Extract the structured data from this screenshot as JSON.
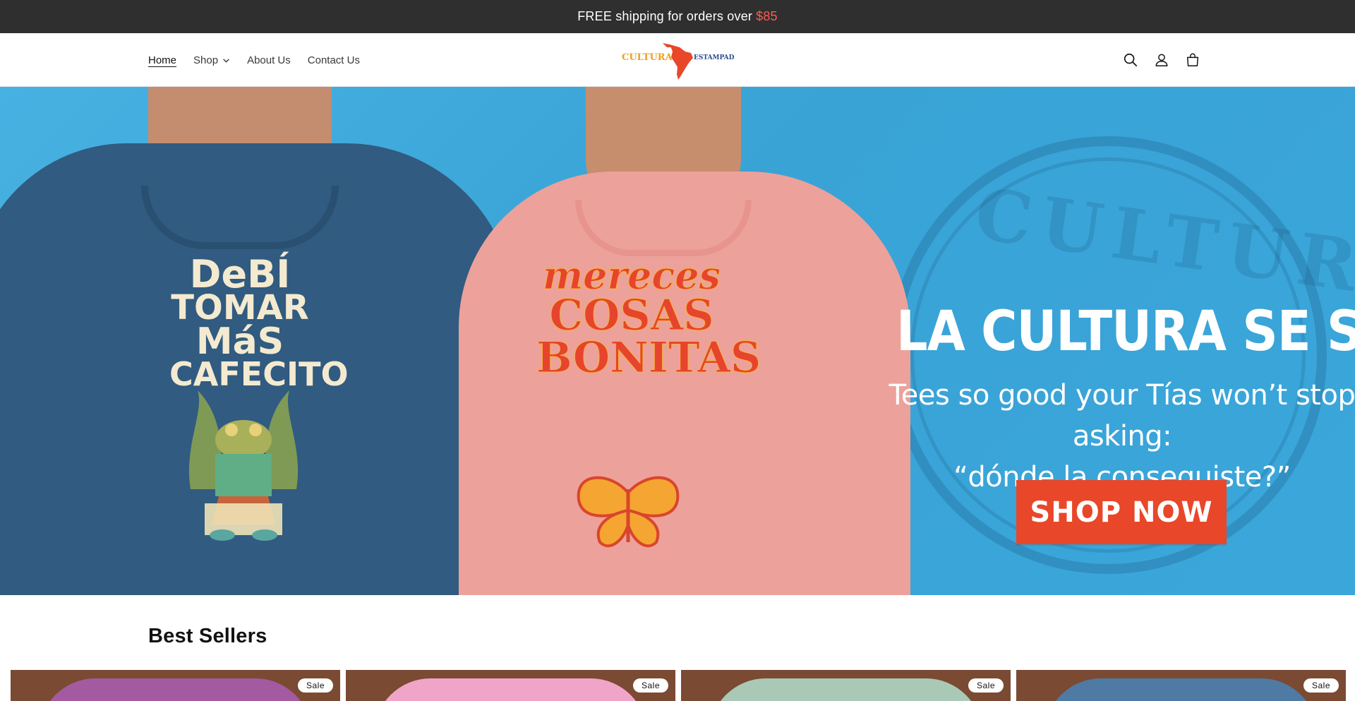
{
  "announcement": {
    "text": "FREE shipping for orders over",
    "amount": "$85"
  },
  "nav": {
    "items": [
      {
        "label": "Home",
        "active": true
      },
      {
        "label": "Shop",
        "dropdown": true
      },
      {
        "label": "About Us"
      },
      {
        "label": "Contact Us"
      }
    ]
  },
  "logo": {
    "left_word": "CULTURA",
    "right_word": "ESTAMPADA"
  },
  "header_icons": [
    "search-icon",
    "account-icon",
    "cart-icon"
  ],
  "hero": {
    "headline": "LA CULTURA SE SIENTE",
    "subline_1": "Tees so good your Tías won’t stop asking:",
    "subline_2": "“dónde la conseguiste?”",
    "cta": "SHOP NOW",
    "blue_tee_lines": [
      "DeBÍ",
      "TOMAR",
      "MáS",
      "CAFECITO"
    ],
    "pink_tee_lines": [
      "mereces",
      "COSAS",
      "BONITAS"
    ],
    "stamp_text": "CULTURA",
    "colors": {
      "sky": "#3aa7d8",
      "cta": "#e8472a",
      "blue_tee": "#315b80",
      "pink_tee": "#eda19b"
    }
  },
  "best_sellers": {
    "title": "Best Sellers",
    "products": [
      {
        "badge": "Sale",
        "shirt_color": "#a45aa0",
        "bg": "#7a4a33"
      },
      {
        "badge": "Sale",
        "shirt_color": "#f0a5c8",
        "bg": "#7a4a33"
      },
      {
        "badge": "Sale",
        "shirt_color": "#a9c9b6",
        "bg": "#7a4a33"
      },
      {
        "badge": "Sale",
        "shirt_color": "#4f7aa3",
        "bg": "#7a4a33"
      }
    ]
  }
}
